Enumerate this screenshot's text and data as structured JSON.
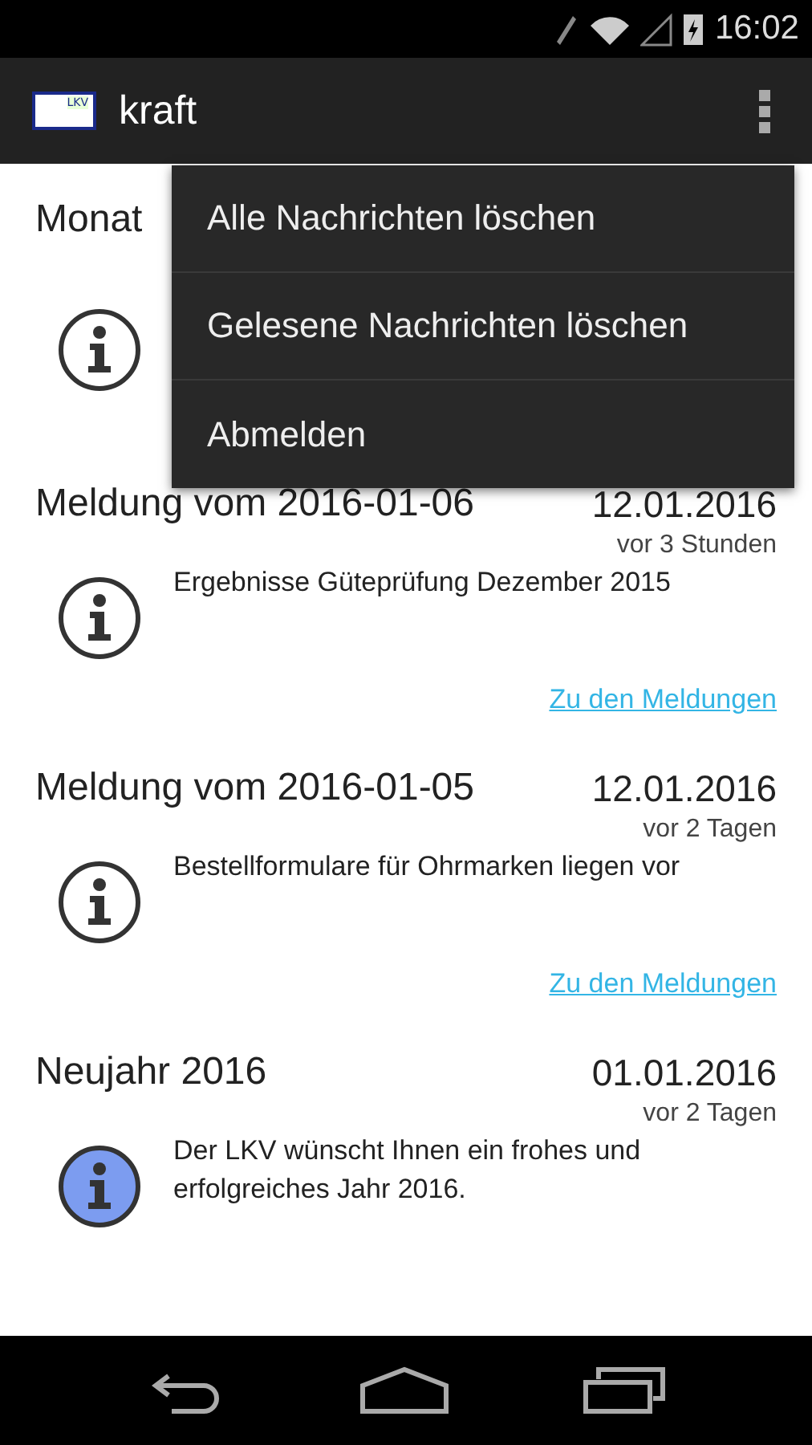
{
  "status_bar": {
    "time": "16:02"
  },
  "action_bar": {
    "title": "kraft",
    "logo_text": "LKV"
  },
  "messages": [
    {
      "title": "Monat",
      "read": true
    },
    {
      "title": "Meldung vom 2016-01-06",
      "date": "12.01.2016",
      "ago": "vor 3 Stunden",
      "body": "Ergebnisse Güteprüfung Dezember 2015",
      "link": "Zu den Meldungen",
      "read": true
    },
    {
      "title": "Meldung vom 2016-01-05",
      "date": "12.01.2016",
      "ago": "vor 2 Tagen",
      "body": "Bestellformulare für Ohrmarken liegen vor",
      "link": "Zu den Meldungen",
      "read": true
    },
    {
      "title": "Neujahr 2016",
      "date": "01.01.2016",
      "ago": "vor 2 Tagen",
      "body": "Der LKV wünscht Ihnen ein frohes und erfolgreiches Jahr 2016.",
      "read": false
    }
  ],
  "menu": {
    "items": [
      "Alle Nachrichten löschen",
      "Gelesene Nachrichten löschen",
      "Abmelden"
    ]
  }
}
